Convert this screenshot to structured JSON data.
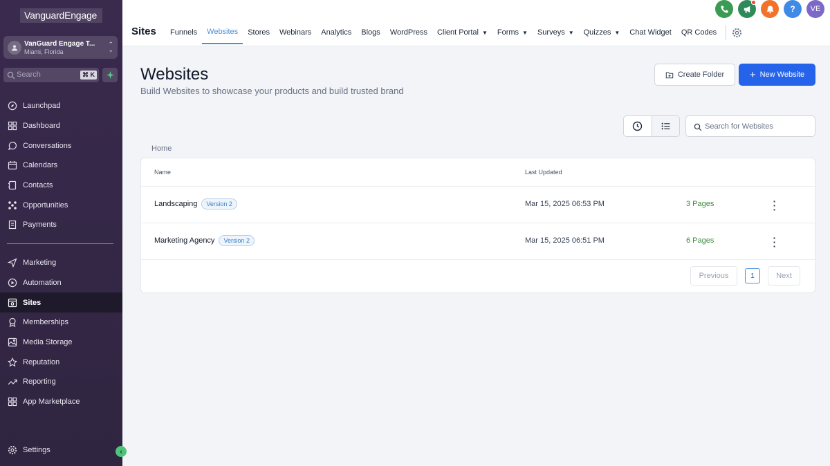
{
  "brand": {
    "logo_text": "VanguardEngage"
  },
  "account": {
    "name": "VanGuard Engage T...",
    "location": "Miami, Florida"
  },
  "sidebar_search": {
    "placeholder": "Search",
    "shortcut": "⌘ K"
  },
  "nav_top": [
    {
      "label": "Launchpad",
      "icon": "rocket-icon"
    },
    {
      "label": "Dashboard",
      "icon": "grid-icon"
    },
    {
      "label": "Conversations",
      "icon": "chat-icon"
    },
    {
      "label": "Calendars",
      "icon": "calendar-icon"
    },
    {
      "label": "Contacts",
      "icon": "contacts-icon"
    },
    {
      "label": "Opportunities",
      "icon": "pipeline-icon"
    },
    {
      "label": "Payments",
      "icon": "receipt-icon"
    }
  ],
  "nav_bottom": [
    {
      "label": "Marketing",
      "icon": "send-icon"
    },
    {
      "label": "Automation",
      "icon": "automation-icon"
    },
    {
      "label": "Sites",
      "icon": "sites-icon",
      "active": true
    },
    {
      "label": "Memberships",
      "icon": "badge-icon"
    },
    {
      "label": "Media Storage",
      "icon": "image-icon"
    },
    {
      "label": "Reputation",
      "icon": "star-icon"
    },
    {
      "label": "Reporting",
      "icon": "trend-icon"
    },
    {
      "label": "App Marketplace",
      "icon": "apps-icon"
    }
  ],
  "settings": {
    "label": "Settings"
  },
  "topbar": {
    "title": "Sites",
    "tabs": [
      {
        "label": "Funnels"
      },
      {
        "label": "Websites",
        "active": true
      },
      {
        "label": "Stores"
      },
      {
        "label": "Webinars"
      },
      {
        "label": "Analytics"
      },
      {
        "label": "Blogs"
      },
      {
        "label": "WordPress"
      },
      {
        "label": "Client Portal",
        "dropdown": true
      },
      {
        "label": "Forms",
        "dropdown": true
      },
      {
        "label": "Surveys",
        "dropdown": true
      },
      {
        "label": "Quizzes",
        "dropdown": true
      },
      {
        "label": "Chat Widget"
      },
      {
        "label": "QR Codes"
      }
    ],
    "avatar_initials": "VE",
    "help_label": "?"
  },
  "colors": {
    "phone": "#3b9b52",
    "megaphone": "#2f8a5a",
    "bell": "#f0722b",
    "help": "#3f8ae6",
    "avatar": "#7b68c8",
    "primary": "#2563eb"
  },
  "main": {
    "title": "Websites",
    "subtitle": "Build Websites to showcase your products and build trusted brand",
    "create_folder_label": "Create Folder",
    "new_website_label": "New Website",
    "search_placeholder": "Search for Websites",
    "breadcrumb": "Home",
    "columns": {
      "name": "Name",
      "updated": "Last Updated"
    },
    "rows": [
      {
        "name": "Landscaping",
        "version": "Version 2",
        "updated": "Mar 15, 2025 06:53 PM",
        "pages": "3 Pages"
      },
      {
        "name": "Marketing Agency",
        "version": "Version 2",
        "updated": "Mar 15, 2025 06:51 PM",
        "pages": "6 Pages"
      }
    ],
    "pagination": {
      "previous": "Previous",
      "page": "1",
      "next": "Next"
    }
  }
}
